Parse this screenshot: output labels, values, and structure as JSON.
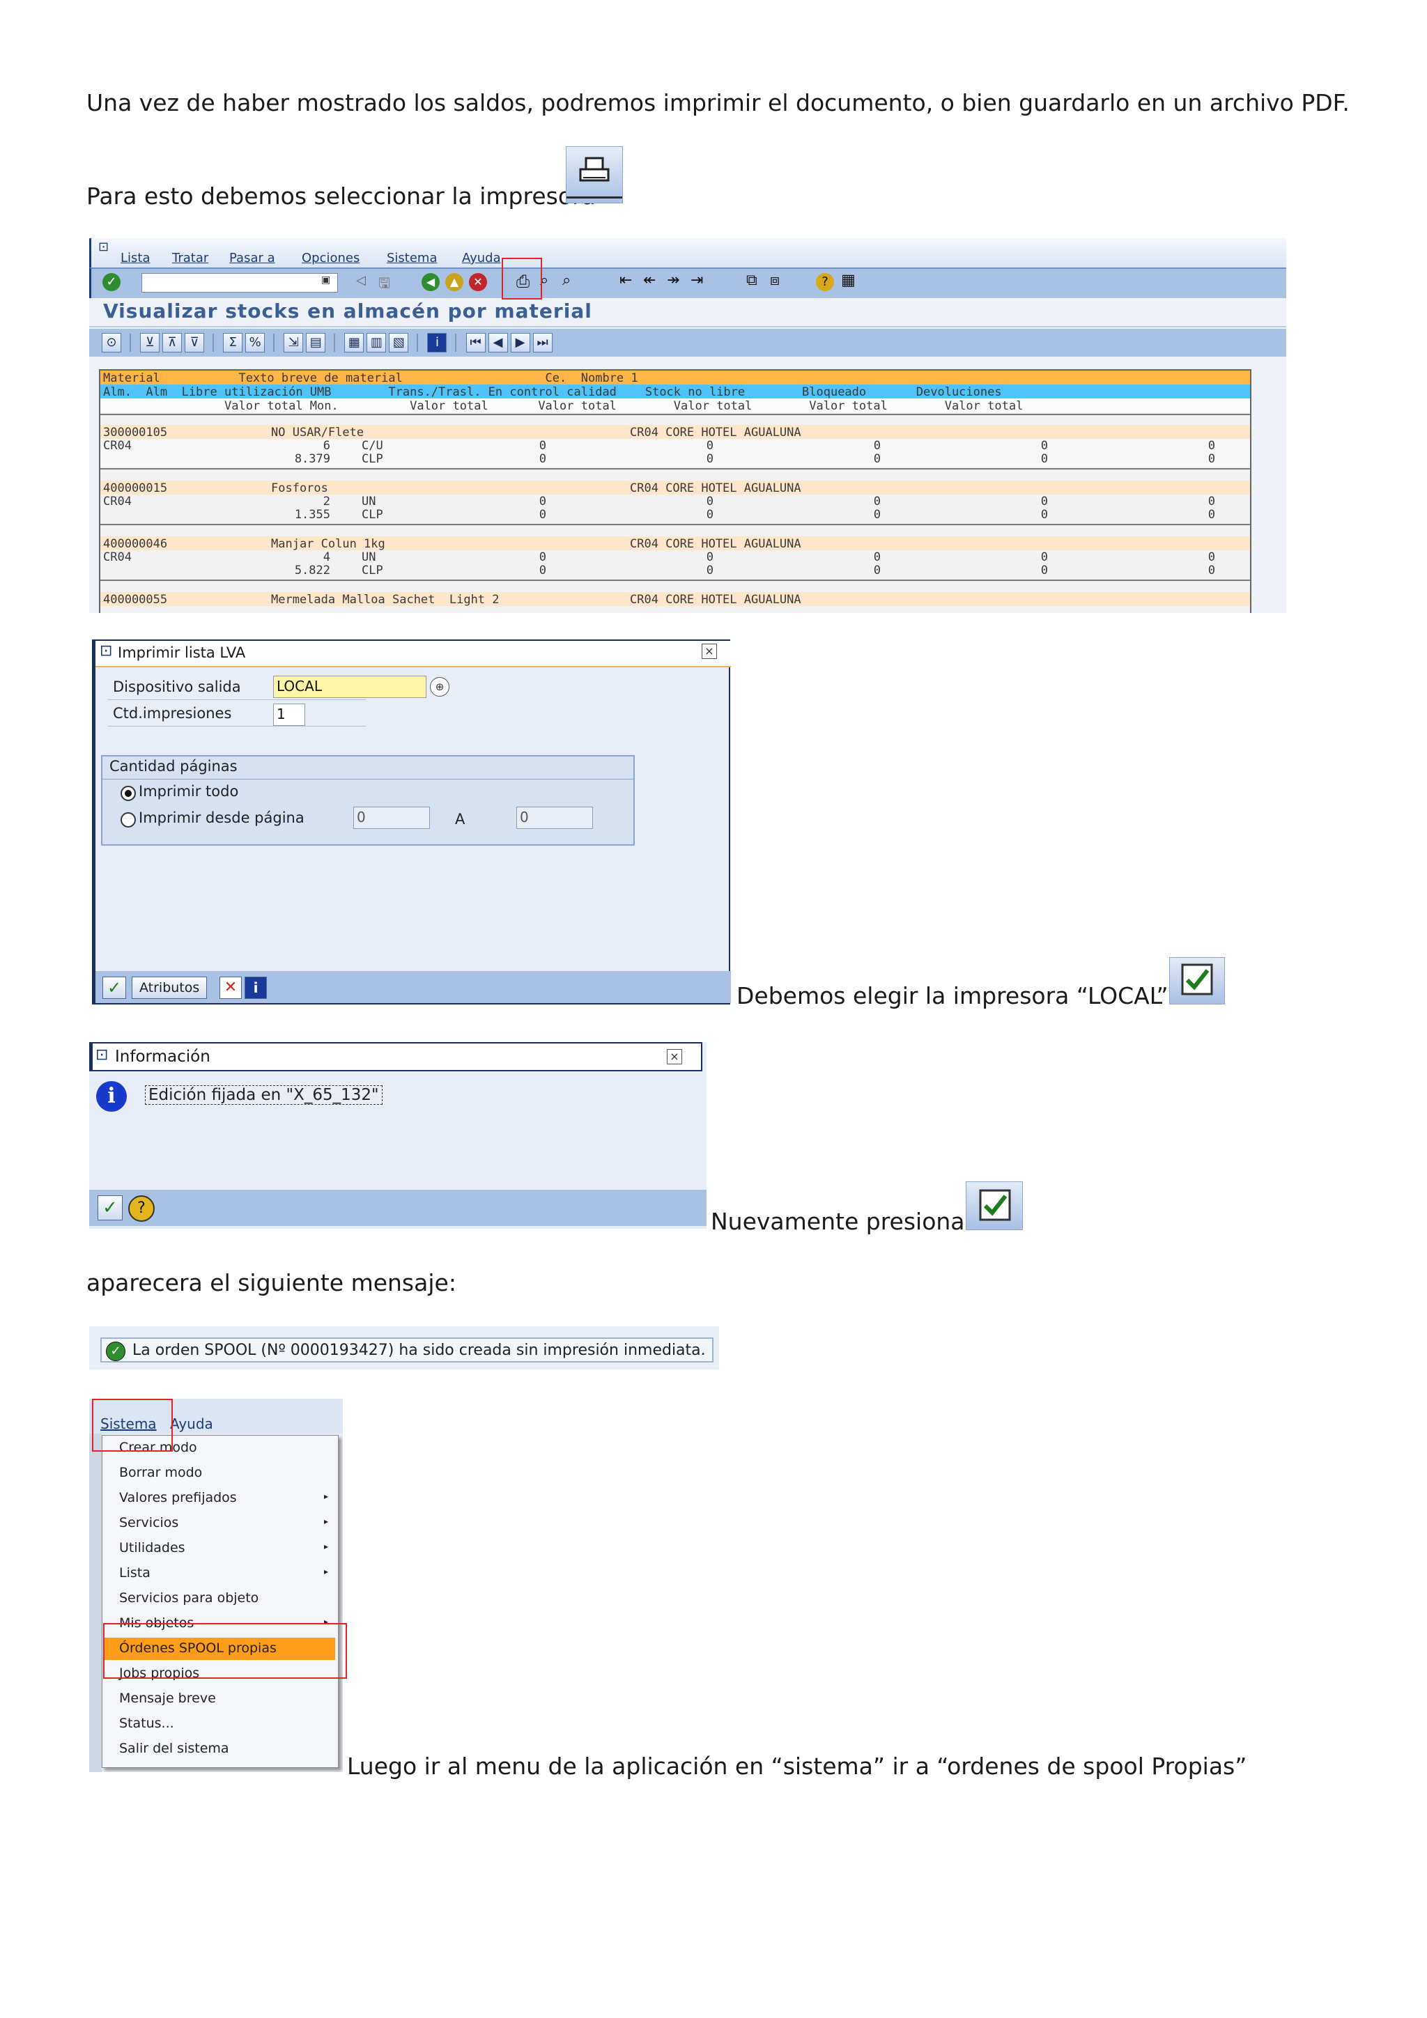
{
  "intro_text": "Una vez de haber mostrado los saldos, podremos imprimir  el documento, o bien guardarlo en un archivo PDF.",
  "select_printer_text": "Para esto debemos seleccionar la impresora",
  "sap_report": {
    "menu": [
      "Lista",
      "Tratar",
      "Pasar a",
      "Opciones",
      "Sistema",
      "Ayuda"
    ],
    "title": "Visualizar stocks en almacén por material",
    "header_rows": [
      "Material           Texto breve de material                    Ce.  Nombre 1",
      "Alm.  Alm  Libre utilización UMB        Trans./Trasl. En control calidad    Stock no libre        Bloqueado       Devoluciones",
      "                 Valor total Mon.          Valor total       Valor total        Valor total        Valor total        Valor total"
    ],
    "materials": [
      {
        "code": "300000105",
        "desc": "NO USAR/Flete",
        "plant": "CR04 CORE HOTEL AGUALUNA",
        "alm": "CR04",
        "qty": "6",
        "umb": "C/U",
        "value": "8.379",
        "currency": "CLP",
        "zeros": "0"
      },
      {
        "code": "400000015",
        "desc": "Fosforos",
        "plant": "CR04 CORE HOTEL AGUALUNA",
        "alm": "CR04",
        "qty": "2",
        "umb": "UN",
        "value": "1.355",
        "currency": "CLP",
        "zeros": "0"
      },
      {
        "code": "400000046",
        "desc": "Manjar Colun 1kg",
        "plant": "CR04 CORE HOTEL AGUALUNA",
        "alm": "CR04",
        "qty": "4",
        "umb": "UN",
        "value": "5.822",
        "currency": "CLP",
        "zeros": "0"
      },
      {
        "code": "400000055",
        "desc": "Mermelada Malloa Sachet  Light 2",
        "plant": "CR04 CORE HOTEL AGUALUNA"
      }
    ]
  },
  "print_dialog": {
    "title": "Imprimir lista LVA",
    "device_label": "Dispositivo salida",
    "device_value": "LOCAL",
    "copies_label": "Ctd.impresiones",
    "copies_value": "1",
    "pages_group": "Cantidad páginas",
    "print_all": "Imprimir todo",
    "print_from": "Imprimir desde página",
    "from_value": "0",
    "to_label": "A",
    "to_value": "0",
    "attributes_button": "Atributos"
  },
  "choose_local_text": "Debemos elegir la impresora “LOCAL” Y",
  "info_dialog": {
    "title": "Información",
    "message": "Edición fijada en \"X_65_132\""
  },
  "press_again_text": "Nuevamente presionar",
  "message_intro_text": "aparecera el siguiente mensaje:",
  "spool_message": "La orden SPOOL (Nº 0000193427) ha sido creada sin impresión inmediata.",
  "system_menu": {
    "bar": [
      "Sistema",
      "Ayuda"
    ],
    "items": [
      {
        "label": "Crear modo",
        "sub": false
      },
      {
        "label": "Borrar modo",
        "sub": false
      },
      {
        "label": "Valores prefijados",
        "sub": true
      },
      {
        "label": "Servicios",
        "sub": true
      },
      {
        "label": "Utilidades",
        "sub": true
      },
      {
        "label": "Lista",
        "sub": true
      },
      {
        "label": "Servicios para objeto",
        "sub": false
      },
      {
        "label": "Mis objetos",
        "sub": true
      },
      {
        "label": "Órdenes SPOOL propias",
        "sub": false,
        "highlighted": true
      },
      {
        "label": "Jobs propios",
        "sub": false
      },
      {
        "label": "Mensaje breve",
        "sub": false
      },
      {
        "label": "Status...",
        "sub": false
      },
      {
        "label": "Salir del sistema",
        "sub": false
      }
    ]
  },
  "go_menu_text": "Luego ir al menu de la aplicación en “sistema” ir a “ordenes de spool Propias”",
  "colors": {
    "sap_blue": "#a9c1e3",
    "sap_light": "#e9eef6",
    "orange_band": "#ffb547",
    "cyan_band": "#4fc3f7",
    "highlight": "#ff9c1a",
    "red_box": "#e0262b"
  }
}
